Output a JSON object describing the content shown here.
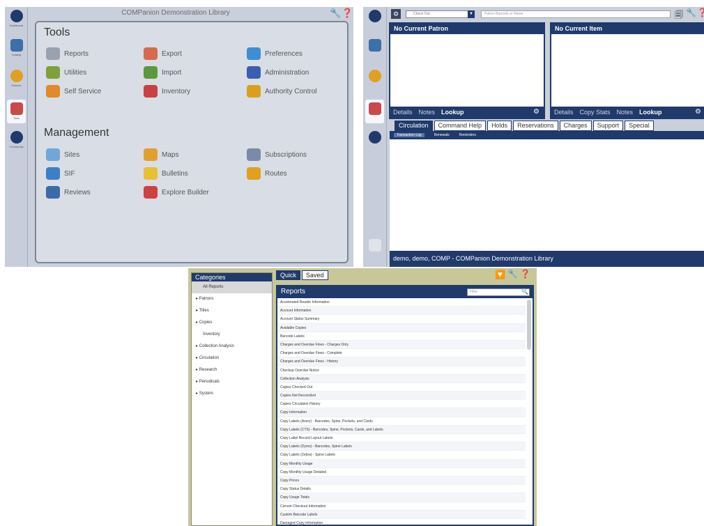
{
  "tools_pane": {
    "title": "COMPanion Demonstration Library",
    "nav": [
      "Dashboard",
      "Catalog",
      "Patrons",
      "Tools",
      "Community"
    ],
    "tools_heading": "Tools",
    "tools": [
      {
        "label": "Reports",
        "color": "#9aa2b0"
      },
      {
        "label": "Export",
        "color": "#d66a4a"
      },
      {
        "label": "Preferences",
        "color": "#3c8fd6"
      },
      {
        "label": "Utilities",
        "color": "#7fa03a"
      },
      {
        "label": "Import",
        "color": "#5a9a3a"
      },
      {
        "label": "Administration",
        "color": "#3a5fb0"
      },
      {
        "label": "Self Service",
        "color": "#e08a2a"
      },
      {
        "label": "Inventory",
        "color": "#c94040"
      },
      {
        "label": "Authority Control",
        "color": "#d9a020"
      }
    ],
    "management_heading": "Management",
    "management": [
      {
        "label": "Sites",
        "color": "#6fa8d8"
      },
      {
        "label": "Maps",
        "color": "#e0a030"
      },
      {
        "label": "Subscriptions",
        "color": "#7a8aa8"
      },
      {
        "label": "SIF",
        "color": "#3c7fc6"
      },
      {
        "label": "Bulletins",
        "color": "#e8c030"
      },
      {
        "label": "Routes",
        "color": "#e0a020"
      },
      {
        "label": "Reviews",
        "color": "#3a6aa8"
      },
      {
        "label": "Explore Builder",
        "color": "#d04040"
      }
    ]
  },
  "circ_pane": {
    "mode_label": "Check Out",
    "scan_placeholder": "Patron Barcode or Name",
    "patron_header": "No Current Patron",
    "item_header": "No Current Item",
    "patron_links": [
      "Details",
      "Notes",
      "Lookup"
    ],
    "item_links": [
      "Details",
      "Copy Stats",
      "Notes",
      "Lookup"
    ],
    "tabs": [
      "Circulation",
      "Command Help",
      "Holds",
      "Reservations",
      "Charges",
      "Support",
      "Special"
    ],
    "subtabs": [
      "Transaction Log",
      "Renewals",
      "Reminders"
    ],
    "status": "demo, demo, COMP - COMPanion Demonstration Library"
  },
  "reports_pane": {
    "categories_header": "Categories",
    "categories": [
      "All Reports",
      "Patrons",
      "Titles",
      "Copies",
      "Inventory",
      "Collection Analysis",
      "Circulation",
      "Research",
      "Periodicals",
      "System"
    ],
    "tabs": [
      "Quick",
      "Saved"
    ],
    "reports_header": "Reports",
    "filter_placeholder": "Filter",
    "reports": [
      "Accelerated Reader Information",
      "Account Information",
      "Account Status Summary",
      "Available Copies",
      "Barcode Labels",
      "Charges and Overdue Fines - Charges Only",
      "Charges and Overdue Fines - Complete",
      "Charges and Overdue Fines - History",
      "Checkup Overdue Notice",
      "Collection Analysis",
      "Copies Checked Out",
      "Copies Not Reconciled",
      "Copies Circulation History",
      "Copy Information",
      "Copy Labels (Avery) - Barcodes, Spine, Pockets, and Cards",
      "Copy Labels (CTS) - Barcodes, Spine, Pockets, Cards, and Labels",
      "Copy Label Record Layout Labels",
      "Copy Labels (Dymo) - Barcodes, Spine Labels",
      "Copy Labels (Zebra) - Spine Labels",
      "Copy Monthly Usage",
      "Copy Monthly Usage Detailed",
      "Copy Prices",
      "Copy Status Details",
      "Copy Usage Totals",
      "Current Checkout Information",
      "Custom Barcode Labels",
      "Damaged Copy Information"
    ]
  },
  "colors": {
    "navy": "#1f3a6b",
    "panel_gray": "#c9cfdb",
    "olive": "#c7c79a"
  }
}
